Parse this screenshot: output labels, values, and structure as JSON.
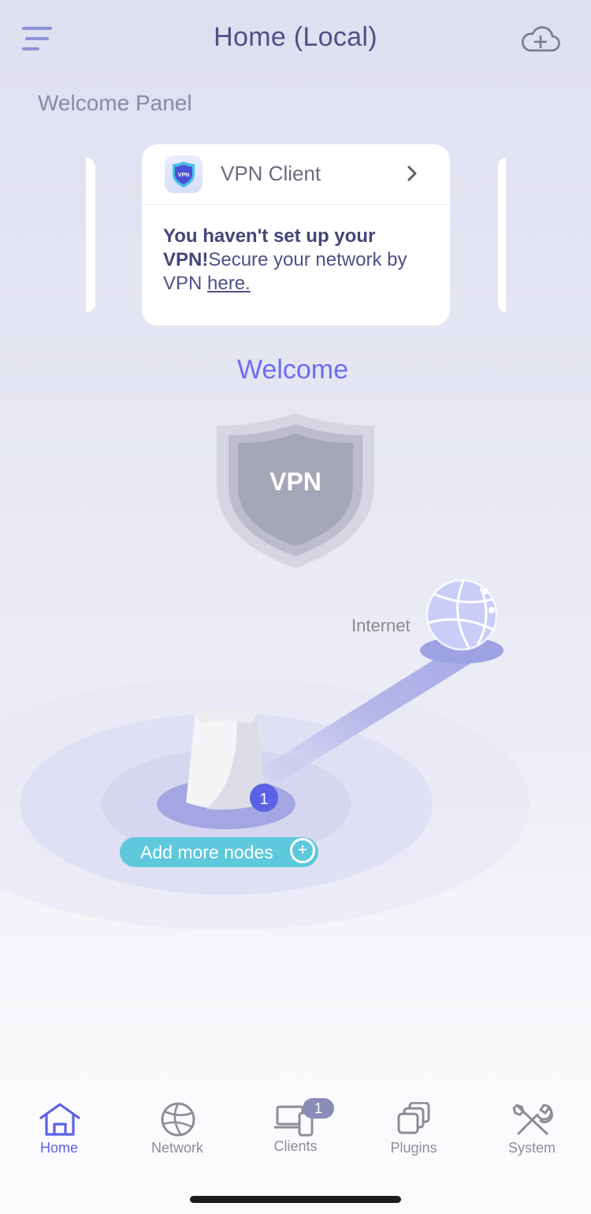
{
  "header": {
    "title": "Home (Local)"
  },
  "welcome_panel": {
    "label": "Welcome Panel",
    "card": {
      "icon_text": "VPN",
      "title": "VPN Client",
      "message_bold": "You haven't set up your VPN!",
      "message": "Secure your network by VPN ",
      "link_text": "here."
    }
  },
  "topology": {
    "welcome": "Welcome",
    "vpn_shield_text": "VPN",
    "internet_label": "Internet",
    "node_count": "1",
    "add_nodes_label": "Add more nodes",
    "add_icon": "+"
  },
  "tabbar": {
    "items": [
      {
        "label": "Home",
        "icon": "home-icon",
        "active": true
      },
      {
        "label": "Network",
        "icon": "globe-icon",
        "active": false
      },
      {
        "label": "Clients",
        "icon": "devices-icon",
        "active": false
      },
      {
        "label": "Plugins",
        "icon": "plugins-icon",
        "active": false
      },
      {
        "label": "System",
        "icon": "tools-icon",
        "active": false
      }
    ],
    "clients_badge": "1"
  },
  "colors": {
    "accent": "#5a62e6",
    "title": "#4f4f88",
    "add_nodes": "#5ec8dc"
  }
}
